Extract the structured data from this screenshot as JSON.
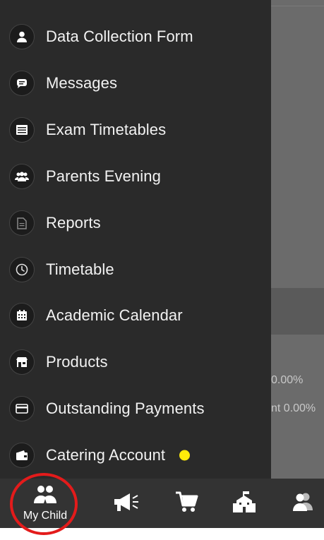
{
  "menu": {
    "items": [
      {
        "label": "Data Collection Form",
        "icon": "person-icon"
      },
      {
        "label": "Messages",
        "icon": "chat-icon"
      },
      {
        "label": "Exam Timetables",
        "icon": "list-icon"
      },
      {
        "label": "Parents Evening",
        "icon": "group-icon"
      },
      {
        "label": "Reports",
        "icon": "document-icon"
      },
      {
        "label": "Timetable",
        "icon": "clock-icon"
      },
      {
        "label": "Academic Calendar",
        "icon": "calendar-icon"
      },
      {
        "label": "Products",
        "icon": "store-icon"
      },
      {
        "label": "Outstanding Payments",
        "icon": "card-icon"
      },
      {
        "label": "Catering Account",
        "icon": "wallet-icon",
        "badge_color": "#ffeb0a"
      }
    ]
  },
  "background": {
    "row_1_value": "0.00%",
    "row_2_value": "nt 0.00%"
  },
  "bottom_nav": {
    "items": [
      {
        "label": "My Child",
        "icon": "children-icon",
        "highlighted": true
      },
      {
        "label": "",
        "icon": "megaphone-icon"
      },
      {
        "label": "",
        "icon": "cart-icon"
      },
      {
        "label": "",
        "icon": "school-icon"
      },
      {
        "label": "",
        "icon": "contacts-icon"
      }
    ],
    "highlight_color": "#e31b1b"
  }
}
